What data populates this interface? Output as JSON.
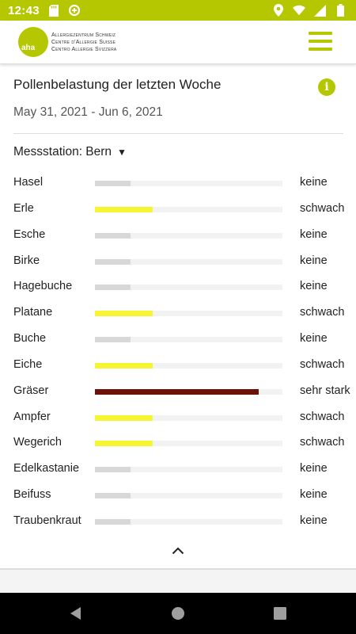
{
  "status_bar": {
    "time": "12:43",
    "left_icons": [
      "sd-card-icon",
      "data-saver-icon"
    ],
    "right_icons": [
      "location-icon",
      "wifi-icon",
      "signal-icon",
      "battery-icon"
    ],
    "color": "#b5c700"
  },
  "header": {
    "logo_mark": "aha",
    "logo_lines": [
      "Allergiezentrum Schweiz",
      "Centre d'Allergie Suisse",
      "Centro Allergie Svizzera"
    ],
    "menu_icon": "hamburger-menu-icon",
    "accent_color": "#b5c700"
  },
  "card": {
    "title": "Pollenbelastung der letzten Woche",
    "info_icon": "i",
    "date_range": "May 31, 2021 - Jun 6, 2021",
    "station_label": "Messstation: Bern",
    "station_caret": "▼",
    "collapse_icon": "chevron-up-icon"
  },
  "levels": {
    "keine": {
      "fraction": 0.19,
      "color": "#d8d8d8"
    },
    "schwach": {
      "fraction": 0.31,
      "color": "#f7f531"
    },
    "sehr stark": {
      "fraction": 0.875,
      "color": "#6b1208"
    }
  },
  "pollen": [
    {
      "name": "Hasel",
      "level": "keine"
    },
    {
      "name": "Erle",
      "level": "schwach"
    },
    {
      "name": "Esche",
      "level": "keine"
    },
    {
      "name": "Birke",
      "level": "keine"
    },
    {
      "name": "Hagebuche",
      "level": "keine"
    },
    {
      "name": "Platane",
      "level": "schwach"
    },
    {
      "name": "Buche",
      "level": "keine"
    },
    {
      "name": "Eiche",
      "level": "schwach"
    },
    {
      "name": "Gräser",
      "level": "sehr stark"
    },
    {
      "name": "Ampfer",
      "level": "schwach"
    },
    {
      "name": "Wegerich",
      "level": "schwach"
    },
    {
      "name": "Edelkastanie",
      "level": "keine"
    },
    {
      "name": "Beifuss",
      "level": "keine"
    },
    {
      "name": "Traubenkraut",
      "level": "keine"
    }
  ],
  "nav_bar": {
    "buttons": [
      "back-icon",
      "home-icon",
      "recents-icon"
    ]
  }
}
